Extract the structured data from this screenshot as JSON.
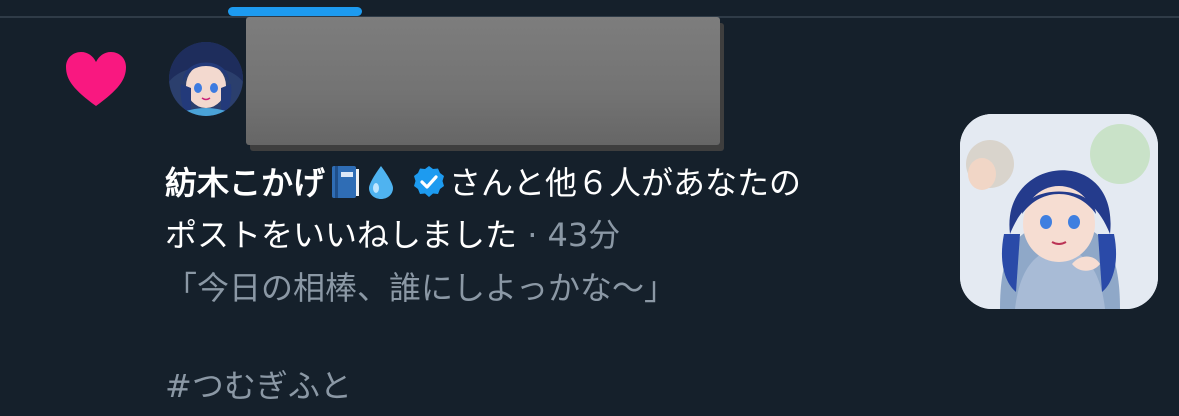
{
  "notification": {
    "type_icon": "heart-icon",
    "liker_name": "紡木こかげ",
    "name_emojis": [
      "book-icon",
      "droplet-icon"
    ],
    "verified_icon": "verified-badge-icon",
    "action_line1": "さんと他６人があなたの",
    "action_line2": "ポストをいいねしました",
    "separator": "·",
    "timestamp": "43分",
    "quote": "「今日の相棒、誰にしよっかな〜」",
    "hashtag": "#つむぎふと"
  },
  "colors": {
    "background": "#15202b",
    "like": "#f91880",
    "accent": "#1d9bf0",
    "secondary_text": "#8b98a5"
  }
}
